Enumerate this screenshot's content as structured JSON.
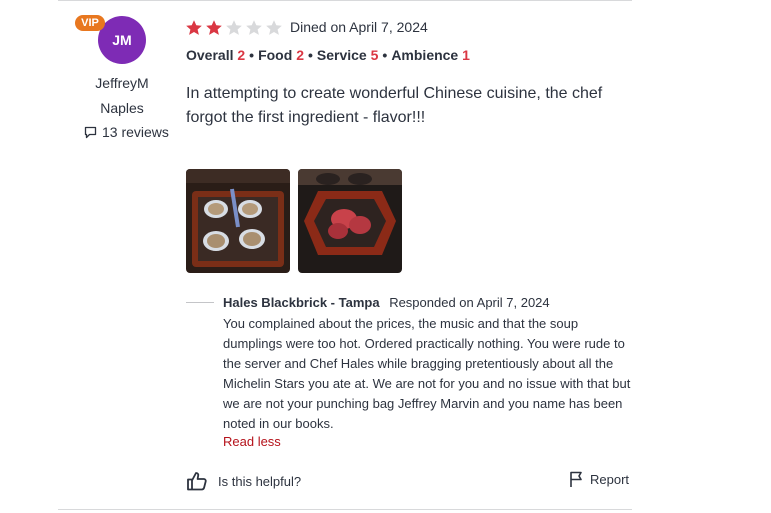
{
  "user": {
    "initials": "JM",
    "vip_badge": "VIP",
    "name": "JeffreyM",
    "location": "Naples",
    "reviews": "13 reviews"
  },
  "review": {
    "star_rating": 2,
    "star_max": 5,
    "dined": "Dined on April 7, 2024",
    "ratings": [
      {
        "label": "Overall",
        "value": "2"
      },
      {
        "label": "Food",
        "value": "2"
      },
      {
        "label": "Service",
        "value": "5"
      },
      {
        "label": "Ambience",
        "value": "1"
      }
    ],
    "text": "In attempting to create wonderful Chinese cuisine, the chef forgot the first ingredient - flavor!!!",
    "photos": [
      "soup-dumplings-photo",
      "steak-skillet-photo"
    ]
  },
  "response": {
    "business": "Hales Blackbrick - Tampa",
    "responded": "Responded on April 7, 2024",
    "body": "You complained about the prices, the music and that the soup dumplings were too hot.  Ordered practically nothing.  You were rude to the server and Chef Hales while bragging pretentiously about all the Michelin Stars you ate at.  We are not for you and no issue with that but we are not your punching bag Jeffrey Marvin and you name has been noted in our books.",
    "read_less": "Read less"
  },
  "actions": {
    "helpful": "Is this helpful?",
    "report": "Report"
  },
  "colors": {
    "accent": "#da3743",
    "avatar": "#7e2bb5",
    "vip": "#e8771f",
    "star_empty": "#d8d9db"
  }
}
